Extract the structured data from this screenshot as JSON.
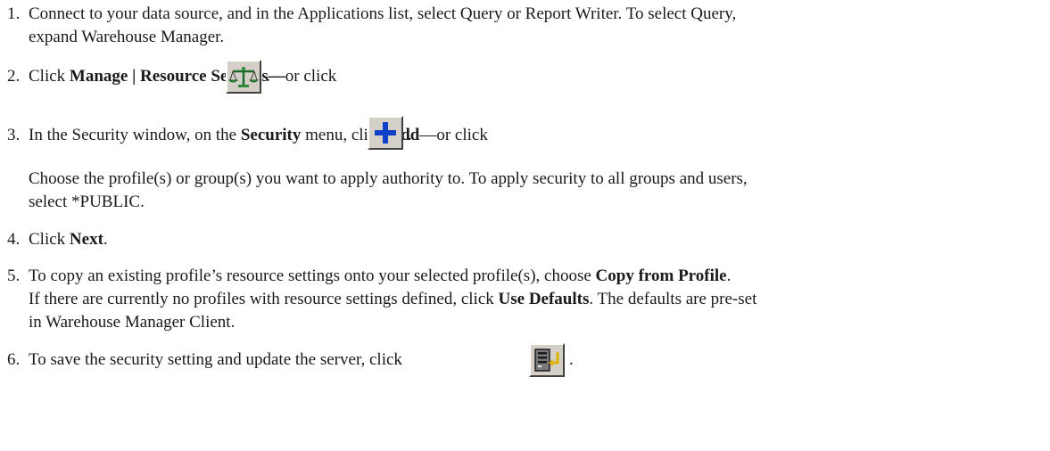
{
  "steps": [
    {
      "num": "1.",
      "line1": "Connect to your data source, and in the Applications list, select Query or Report Writer. To select Query,",
      "line2": "expand Warehouse Manager."
    },
    {
      "num": "2.",
      "pre": "Click ",
      "bold1": "Manage | Resource Settings—",
      "post": "or click",
      "after_icon": "."
    },
    {
      "num": "3.",
      "pre": "In the Security window, on the ",
      "bold1": "Security",
      "mid": " menu, click ",
      "bold2": "Add",
      "post": "—or click",
      "after_icon": "."
    },
    {
      "line1": "Choose the profile(s) or group(s) you want to apply authority to. To apply security to all groups and users,",
      "line2": "select *PUBLIC."
    },
    {
      "num": "4.",
      "pre": "Click ",
      "bold1": "Next",
      "post": "."
    },
    {
      "num": "5.",
      "pre": "To copy an existing profile’s resource settings onto your selected profile(s), choose ",
      "bold1": "Copy from Profile",
      "post": ".",
      "line2_pre": "If there are currently no profiles with resource settings defined, click ",
      "line2_bold": "Use Defaults",
      "line2_post": ". The defaults are pre-set",
      "line3": "in Warehouse Manager Client."
    },
    {
      "num": "6.",
      "pre": "To save the security setting and update the server, click",
      "after_icon": "."
    }
  ],
  "icons": {
    "resource_settings": "scales-icon",
    "add": "plus-icon",
    "save_update": "server-update-icon"
  }
}
